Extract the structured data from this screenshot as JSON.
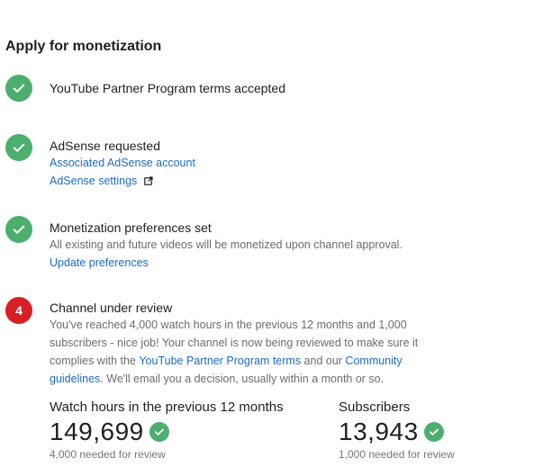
{
  "page": {
    "title": "Apply for monetization"
  },
  "steps": {
    "terms": {
      "title": "YouTube Partner Program terms accepted"
    },
    "adsense": {
      "title": "AdSense requested",
      "account_link": "Associated AdSense account",
      "settings_link": "AdSense settings"
    },
    "preferences": {
      "title": "Monetization preferences set",
      "desc": "All existing and future videos will be monetized upon channel approval.",
      "update_link": "Update preferences"
    },
    "review": {
      "number": "4",
      "title": "Channel under review",
      "desc_line1": "You've reached 4,000 watch hours in the previous 12 months and 1,000",
      "desc_line2": "subscribers - nice job! Your channel is now being reviewed to make sure it",
      "desc_line3_pre": "complies with the ",
      "terms_link": "YouTube Partner Program terms",
      "desc_line3_mid": " and our ",
      "community_link_a": "Community",
      "community_link_b": "guidelines",
      "desc_line4_post": ". We'll email you a decision, usually within a month or so."
    }
  },
  "stats": {
    "watch_hours": {
      "label": "Watch hours in the previous 12 months",
      "value": "149,699",
      "note": "4,000 needed for review"
    },
    "subscribers": {
      "label": "Subscribers",
      "value": "13,943",
      "note": "1,000 needed for review"
    }
  },
  "colors": {
    "success": "#4caf6e",
    "alert": "#d91f26",
    "link": "#1b6cc8"
  }
}
